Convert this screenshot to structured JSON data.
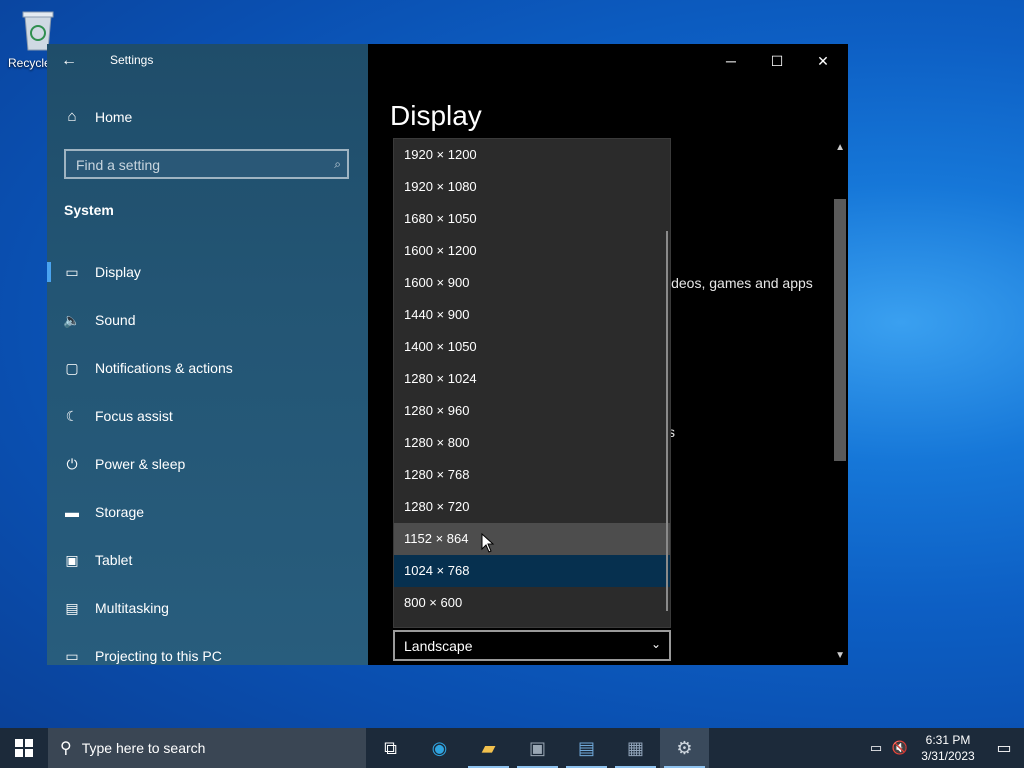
{
  "desktop": {
    "recycle_label": "Recycle Bin"
  },
  "window": {
    "app_title": "Settings",
    "back_icon": "back-arrow-icon",
    "controls": {
      "minimize": "─",
      "maximize": "☐",
      "close": "✕"
    }
  },
  "nav": {
    "home_label": "Home",
    "search_placeholder": "Find a setting",
    "section": "System",
    "items": [
      {
        "label": "Display",
        "icon": "monitor-icon",
        "glyph": "▭",
        "active": true
      },
      {
        "label": "Sound",
        "icon": "speaker-icon",
        "glyph": "🔈"
      },
      {
        "label": "Notifications & actions",
        "icon": "notification-icon",
        "glyph": "▢"
      },
      {
        "label": "Focus assist",
        "icon": "moon-icon",
        "glyph": "☾"
      },
      {
        "label": "Power & sleep",
        "icon": "power-icon",
        "glyph": "⏻"
      },
      {
        "label": "Storage",
        "icon": "storage-icon",
        "glyph": "▬"
      },
      {
        "label": "Tablet",
        "icon": "tablet-icon",
        "glyph": "▣"
      },
      {
        "label": "Multitasking",
        "icon": "multitasking-icon",
        "glyph": "▤"
      },
      {
        "label": "Projecting to this PC",
        "icon": "projecting-icon",
        "glyph": "▭"
      }
    ]
  },
  "content": {
    "page_title": "Display",
    "bg_text_1": "ideos, games and apps",
    "bg_text_2": "s",
    "resolution_options": [
      "1920 × 1200",
      "1920 × 1080",
      "1680 × 1050",
      "1600 × 1200",
      "1600 × 900",
      "1440 × 900",
      "1400 × 1050",
      "1280 × 1024",
      "1280 × 960",
      "1280 × 800",
      "1280 × 768",
      "1280 × 720",
      "1152 × 864",
      "1024 × 768",
      "800 × 600"
    ],
    "hovered_option": "1152 × 864",
    "selected_option": "1024 × 768",
    "orientation_value": "Landscape"
  },
  "taskbar": {
    "search_placeholder": "Type here to search",
    "time": "6:31 PM",
    "date": "3/31/2023",
    "apps": [
      {
        "name": "task-view-icon",
        "glyph": "⧉"
      },
      {
        "name": "edge-icon",
        "glyph": "◉",
        "color": "#2fa4e0"
      },
      {
        "name": "file-explorer-icon",
        "glyph": "▰",
        "color": "#f2c14e"
      },
      {
        "name": "app-icon-1",
        "glyph": "▣",
        "color": "#9aa7b4"
      },
      {
        "name": "app-icon-2",
        "glyph": "▤",
        "color": "#6fa8d8"
      },
      {
        "name": "app-icon-3",
        "glyph": "▦",
        "color": "#8fa2b8"
      },
      {
        "name": "settings-icon",
        "glyph": "⚙",
        "color": "#d0d8e0"
      }
    ]
  },
  "colors": {
    "accent": "#4aa3f0",
    "selected_item": "#06304f",
    "nav_bg": "#235574"
  }
}
